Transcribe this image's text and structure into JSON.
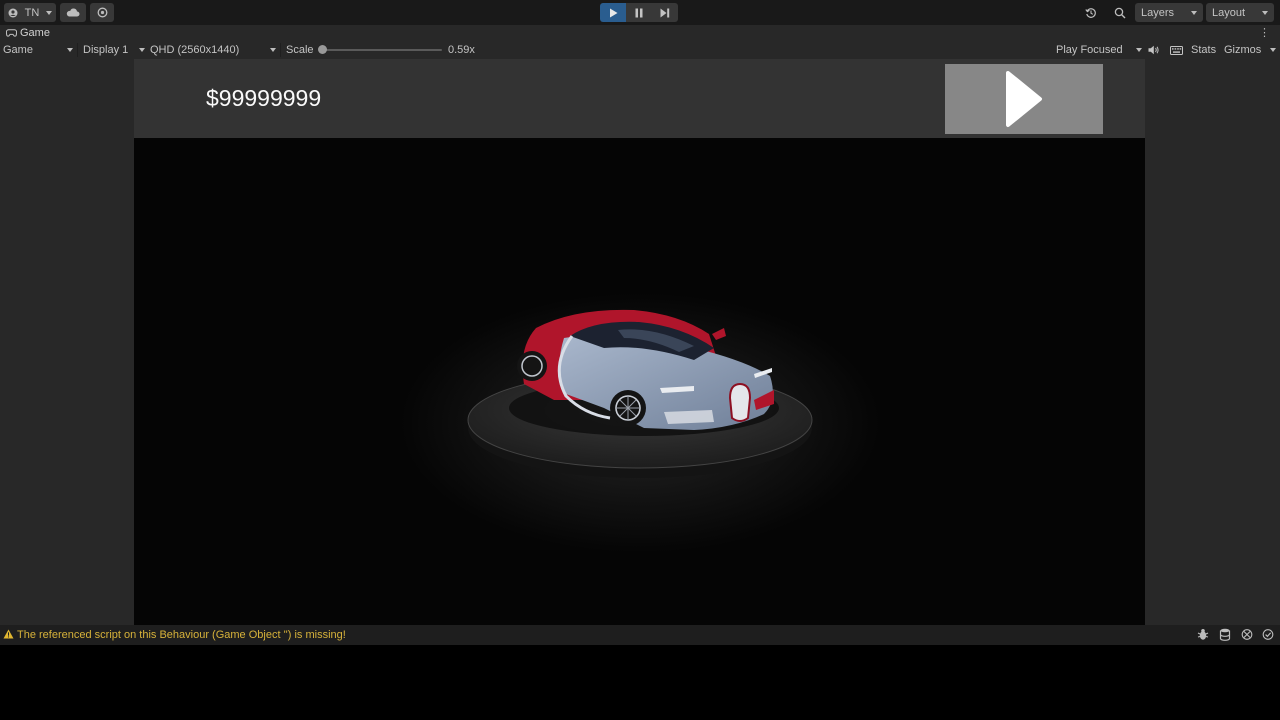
{
  "toolbar": {
    "account_label": "TN",
    "layers_label": "Layers",
    "layout_label": "Layout"
  },
  "tab": {
    "title": "Game"
  },
  "game_toolbar": {
    "view_mode": "Game",
    "display": "Display 1",
    "resolution": "QHD (2560x1440)",
    "scale_label": "Scale",
    "scale_value": "0.59x",
    "scale_fraction": 0.0,
    "play_mode": "Play Focused",
    "stats_label": "Stats",
    "gizmos_label": "Gizmos"
  },
  "game": {
    "money": "$99999999"
  },
  "status": {
    "message": "The referenced script on this Behaviour (Game Object '') is missing!",
    "warning_color": "#d7b23a"
  },
  "colors": {
    "accent_play": "#2a5d8f",
    "panel": "#282828",
    "toolbar": "#191919"
  }
}
